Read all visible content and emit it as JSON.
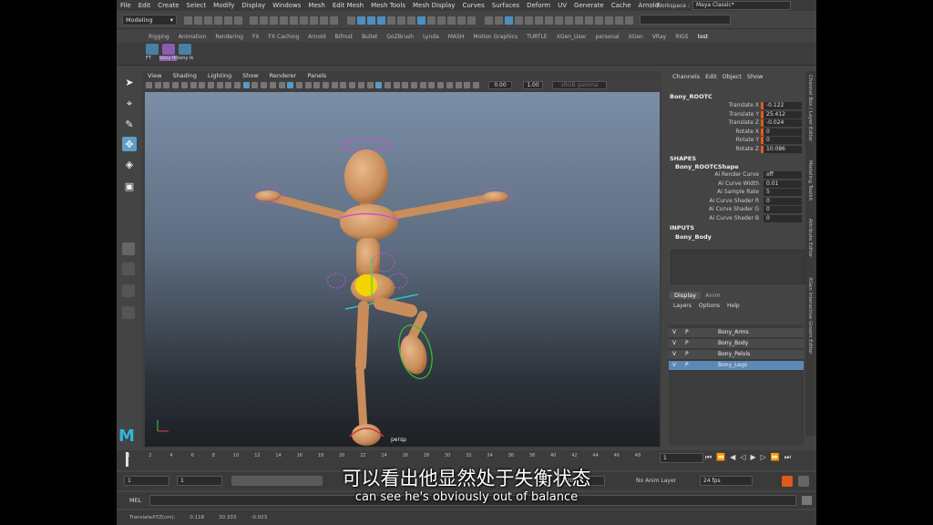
{
  "menubar": [
    "File",
    "Edit",
    "Create",
    "Select",
    "Modify",
    "Display",
    "Windows",
    "Mesh",
    "Edit Mesh",
    "Mesh Tools",
    "Mesh Display",
    "Curves",
    "Surfaces",
    "Deform",
    "UV",
    "Generate",
    "Cache",
    "Arnold"
  ],
  "workspace": {
    "label": "Workspace :",
    "value": "Maya Classic*"
  },
  "statusline": {
    "mode": "Modeling"
  },
  "shelf": {
    "tabs": [
      "Rigging",
      "Animation",
      "Rendering",
      "FX",
      "FX Caching",
      "Arnold",
      "Bifrost",
      "Bullet",
      "GoZBrush",
      "Lynda",
      "MASH",
      "Motion Graphics",
      "TURTLE",
      "XGen_User",
      "personal",
      "XGen",
      "VRay",
      "RIGS",
      "test"
    ],
    "active_tab": "test",
    "buttons": [
      "FT",
      "bony fk",
      "bony ik"
    ]
  },
  "panel": {
    "menus": [
      "View",
      "Shading",
      "Lighting",
      "Show",
      "Renderer",
      "Panels"
    ],
    "near": "0.00",
    "far": "1.00",
    "colorspace": "sRGB gamma",
    "camera": "persp"
  },
  "channelbox": {
    "menus": [
      "Channels",
      "Edit",
      "Object",
      "Show"
    ],
    "object": "Bony_ROOTC",
    "channels": [
      {
        "label": "Translate X",
        "value": "-0.122"
      },
      {
        "label": "Translate Y",
        "value": "25.412"
      },
      {
        "label": "Translate Z",
        "value": "-0.024"
      },
      {
        "label": "Rotate X",
        "value": "0"
      },
      {
        "label": "Rotate Y",
        "value": "0"
      },
      {
        "label": "Rotate Z",
        "value": "10.086"
      }
    ],
    "shapes_header": "SHAPES",
    "shape_name": "Bony_ROOTCShape",
    "shape_attrs": [
      {
        "label": "Ai Render Curve",
        "value": "off"
      },
      {
        "label": "Ai Curve Width",
        "value": "0.01"
      },
      {
        "label": "Ai Sample Rate",
        "value": "5"
      },
      {
        "label": "Ai Curve Shader R",
        "value": "0"
      },
      {
        "label": "Ai Curve Shader G",
        "value": "0"
      },
      {
        "label": "Ai Curve Shader B",
        "value": "0"
      }
    ],
    "inputs_header": "INPUTS",
    "input_name": "Bony_Body"
  },
  "side_tabs": [
    "Channel Box / Layer Editor",
    "Modeling Toolkit",
    "Attribute Editor",
    "XGen Interactive Groom Editor"
  ],
  "layers": {
    "tabs": [
      "Display",
      "Anim"
    ],
    "menus": [
      "Layers",
      "Options",
      "Help"
    ],
    "rows": [
      {
        "v": "V",
        "p": "P",
        "name": "Bony_Arms"
      },
      {
        "v": "V",
        "p": "P",
        "name": "Bony_Body"
      },
      {
        "v": "V",
        "p": "P",
        "name": "Bony_Pelvis"
      },
      {
        "v": "V",
        "p": "P",
        "name": "Bony_Legs"
      }
    ]
  },
  "timeline": {
    "ticks": [
      "1",
      "2",
      "4",
      "6",
      "8",
      "10",
      "12",
      "14",
      "16",
      "18",
      "20",
      "22",
      "24",
      "26",
      "28",
      "30",
      "32",
      "34",
      "36",
      "38",
      "40",
      "42",
      "44",
      "46",
      "48"
    ],
    "current_frame": "1"
  },
  "range": {
    "start": "1",
    "start2": "1",
    "end": "120",
    "anim_layer": "No Anim Layer",
    "fps": "24 fps"
  },
  "mel": {
    "label": "MEL"
  },
  "helpline": [
    "TranslateXYZ(cm):",
    "0.118",
    "30.333",
    "-0.023"
  ],
  "subtitles": {
    "zh": "可以看出他显然处于失衡状态",
    "en": "can see he's obviously out of balance"
  },
  "logo": {
    "letter": "M"
  }
}
